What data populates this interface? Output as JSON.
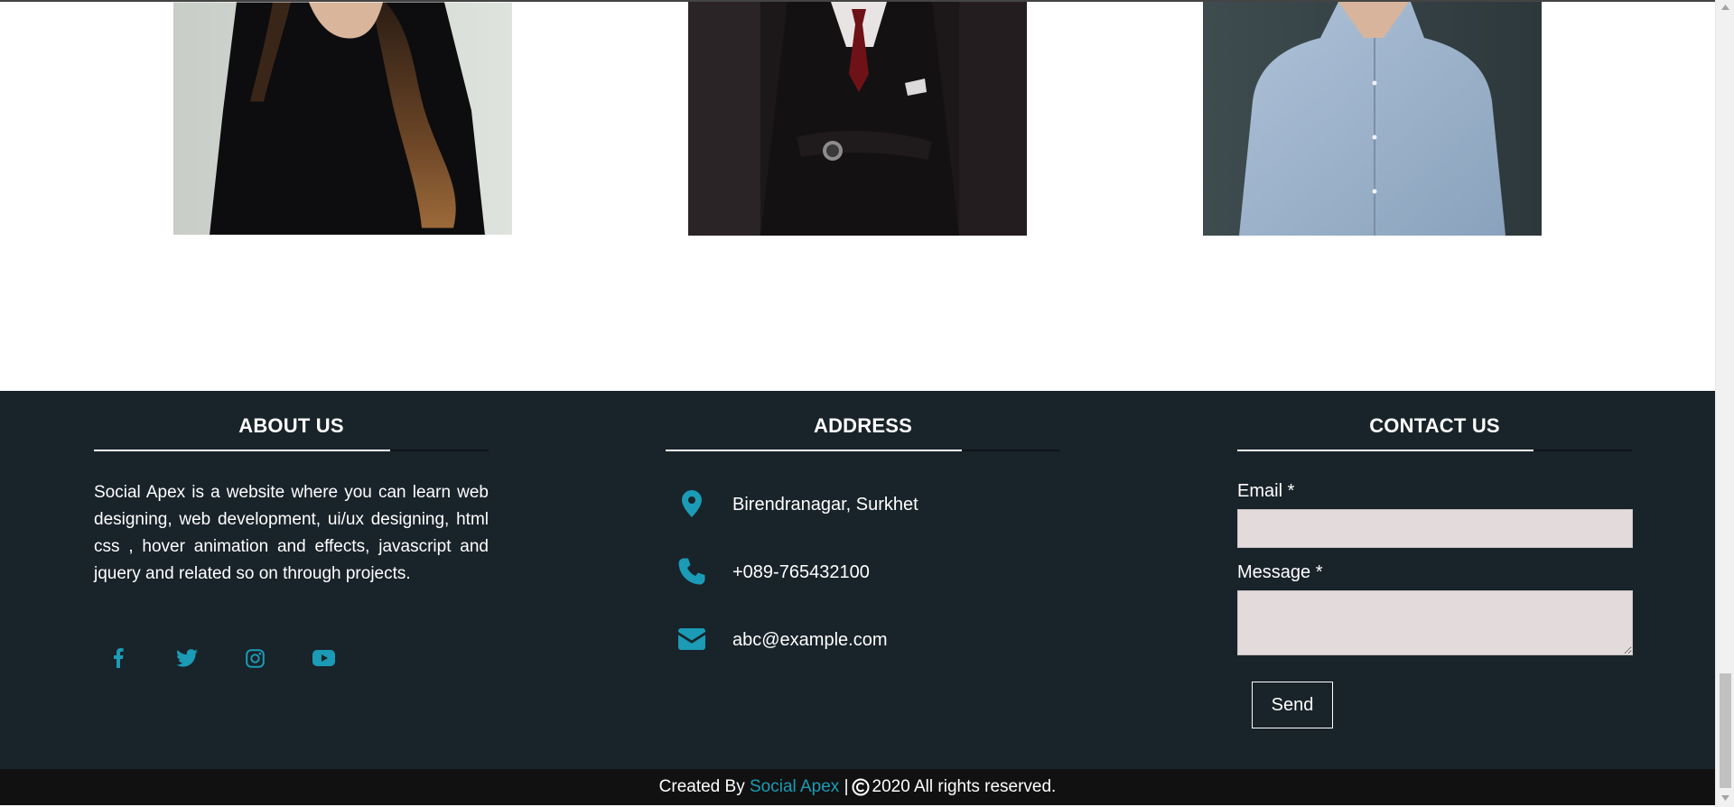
{
  "team_photos": [
    {
      "name": "woman-black-top"
    },
    {
      "name": "man-dark-suit"
    },
    {
      "name": "man-blue-shirt"
    }
  ],
  "about": {
    "heading": "ABOUT US",
    "text": "Social Apex is a website where you can learn web designing, web development, ui/ux designing, html css , hover animation and effects, javascript and jquery and related so on through projects.",
    "social_icons": [
      "facebook-icon",
      "twitter-icon",
      "instagram-icon",
      "youtube-icon"
    ]
  },
  "address": {
    "heading": "ADDRESS",
    "location": "Birendranagar, Surkhet",
    "phone": "+089-765432100",
    "email": "abc@example.com"
  },
  "contact": {
    "heading": "CONTACT US",
    "email_label": "Email *",
    "email_value": "",
    "message_label": "Message *",
    "message_value": "",
    "send_label": "Send"
  },
  "copyright": {
    "prefix": "Created By",
    "brand": "Social Apex",
    "separator": "|",
    "suffix": "2020 All rights reserved."
  },
  "colors": {
    "footer_bg": "#19232a",
    "bottom_bar_bg": "#111111",
    "accent": "#1b9bb5",
    "input_bg": "#e2dadb"
  }
}
